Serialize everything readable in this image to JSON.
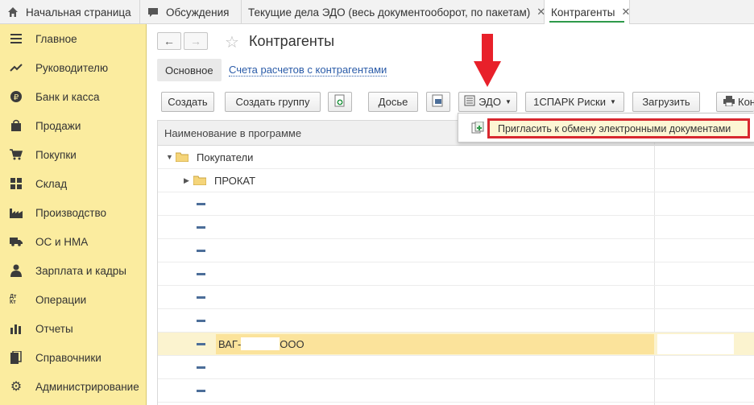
{
  "tabs": [
    {
      "label": "Начальная страница",
      "icon": "home-icon"
    },
    {
      "label": "Обсуждения",
      "icon": "chat-icon"
    },
    {
      "label": "Текущие дела ЭДО (весь документооборот, по пакетам)",
      "close": "✕"
    },
    {
      "label": "Контрагенты",
      "close": "✕",
      "active": true
    }
  ],
  "sidebar": {
    "items": [
      {
        "label": "Главное",
        "icon": "menu-icon"
      },
      {
        "label": "Руководителю",
        "icon": "trend-icon"
      },
      {
        "label": "Банк и касса",
        "icon": "ruble-icon"
      },
      {
        "label": "Продажи",
        "icon": "bag-icon"
      },
      {
        "label": "Покупки",
        "icon": "cart-icon"
      },
      {
        "label": "Склад",
        "icon": "grid-icon"
      },
      {
        "label": "Производство",
        "icon": "factory-icon"
      },
      {
        "label": "ОС и НМА",
        "icon": "truck-icon"
      },
      {
        "label": "Зарплата и кадры",
        "icon": "person-icon"
      },
      {
        "label": "Операции",
        "icon": "dtkt-icon",
        "icon_text": "Дт Кт"
      },
      {
        "label": "Отчеты",
        "icon": "bar-chart-icon"
      },
      {
        "label": "Справочники",
        "icon": "book-icon"
      },
      {
        "label": "Администрирование",
        "icon": "gear-icon"
      }
    ]
  },
  "header": {
    "back": "←",
    "forward": "→",
    "star": "☆",
    "title": "Контрагенты"
  },
  "subtabs": {
    "main": "Основное",
    "link": "Счета расчетов с контрагентами"
  },
  "toolbar": {
    "create": "Создать",
    "create_group": "Создать группу",
    "dossier": "Досье",
    "edo": "ЭДО",
    "spark": "1СПАРК Риски",
    "load": "Загрузить",
    "print": "Кон"
  },
  "table": {
    "header": "Наименование в программе",
    "rows": [
      {
        "type": "group-open",
        "label": "Покупатели"
      },
      {
        "type": "group-closed",
        "label": "ПРОКАТ"
      },
      {
        "type": "item",
        "label": ""
      },
      {
        "type": "item",
        "label": ""
      },
      {
        "type": "item",
        "label": ""
      },
      {
        "type": "item",
        "label": ""
      },
      {
        "type": "item",
        "label": ""
      },
      {
        "type": "item",
        "label": ""
      },
      {
        "type": "item",
        "label": "ВАГ-",
        "suffix": "ООО",
        "selected": true
      },
      {
        "type": "item",
        "label": ""
      },
      {
        "type": "item",
        "label": ""
      }
    ]
  },
  "dropdown": {
    "item": "Пригласить к обмену электронными документами"
  },
  "colors": {
    "sidebar_bg": "#fbec9f",
    "accent_green": "#2e9a4a",
    "highlight_red": "#d8282f",
    "arrow_red": "#e8202a",
    "link_blue": "#2a5ba8"
  }
}
